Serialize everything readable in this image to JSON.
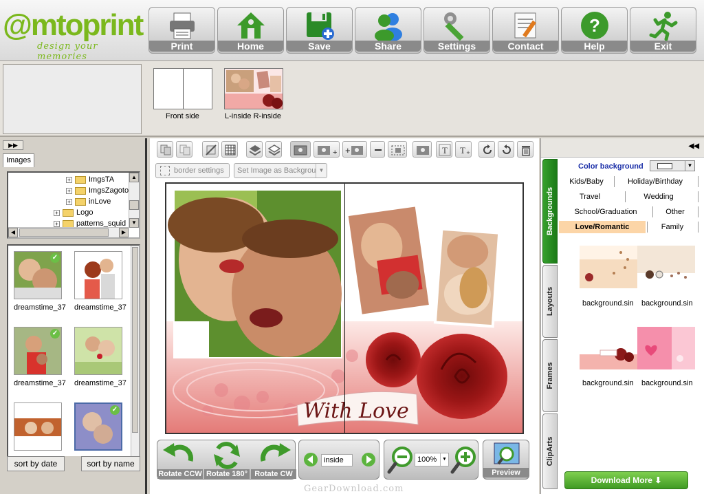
{
  "logo": {
    "main": "@mtoprint",
    "tagline": "design your memories"
  },
  "toolbar": {
    "items": [
      {
        "label": "Print",
        "icon": "printer-icon"
      },
      {
        "label": "Home",
        "icon": "home-icon"
      },
      {
        "label": "Save",
        "icon": "save-icon"
      },
      {
        "label": "Share",
        "icon": "share-users-icon"
      },
      {
        "label": "Settings",
        "icon": "wrench-icon"
      },
      {
        "label": "Contact",
        "icon": "contact-note-icon"
      },
      {
        "label": "Help",
        "icon": "help-icon"
      },
      {
        "label": "Exit",
        "icon": "exit-runner-icon"
      }
    ]
  },
  "pages": {
    "front": "Front side",
    "inside_left": "L-inside",
    "inside_right": "R-inside"
  },
  "left_panel": {
    "collapse": "▶▶",
    "tab": "Images",
    "tree": [
      "ImgsTA",
      "ImgsZagoto",
      "inLove",
      "Logo",
      "patterns_squid"
    ],
    "thumbnails": [
      {
        "label": "dreamstime_37",
        "checked": true
      },
      {
        "label": "dreamstime_37",
        "checked": false
      },
      {
        "label": "dreamstime_37",
        "checked": true
      },
      {
        "label": "dreamstime_37",
        "checked": false
      },
      {
        "label": "",
        "checked": false
      },
      {
        "label": "",
        "checked": true
      }
    ],
    "sort_date": "sort by date",
    "sort_name": "sort by name"
  },
  "editor": {
    "border_settings": "border settings",
    "set_background": "Set Image as Backgrou",
    "canvas_text": "With Love"
  },
  "bottom": {
    "rotate_ccw": "Rotate CCW",
    "rotate_180": "Rotate 180°",
    "rotate_cw": "Rotate CW",
    "page": "inside",
    "zoom": "100%",
    "preview": "Preview"
  },
  "watermark": "GearDownload.com",
  "right_panel": {
    "collapse": "◀◀",
    "tabs": [
      "Backgrounds",
      "Layouts",
      "Frames",
      "ClipArts"
    ],
    "color_background": "Color background",
    "categories": [
      "Kids/Baby",
      "Holiday/Birthday",
      "Travel",
      "Wedding",
      "School/Graduation",
      "Other",
      "Love/Romantic",
      "Family"
    ],
    "active_category": "Love/Romantic",
    "backgrounds": [
      "background.sin",
      "background.sin",
      "background.sin",
      "background.sin"
    ],
    "download_more": "Download More"
  },
  "colors": {
    "accent_green": "#7bb81d",
    "tab_green": "#1b7a17",
    "active_category": "#fcd5a7",
    "link_blue": "#1b2fa8"
  }
}
